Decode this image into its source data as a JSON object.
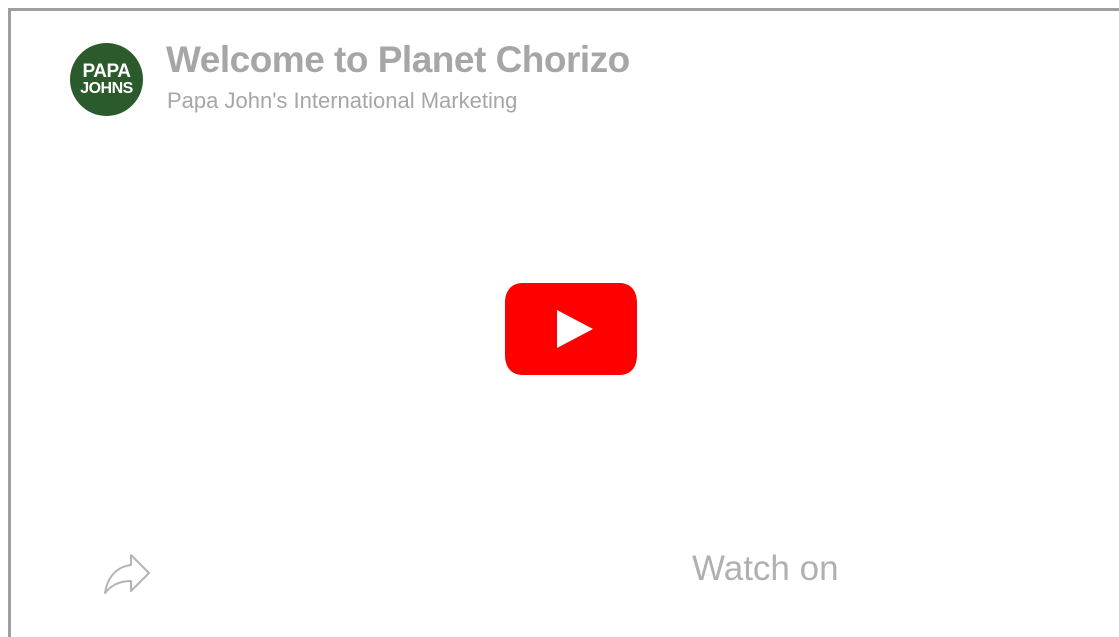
{
  "video": {
    "title": "Welcome to Planet Chorizo",
    "channel": "Papa John's International Marketing"
  },
  "channel_logo": {
    "line1": "PAPA",
    "line2": "JOHNS",
    "color": "#2b5a2d"
  },
  "controls": {
    "play_icon": "youtube-play-icon",
    "share_icon": "share-arrow-icon",
    "watch_on_label": "Watch on"
  },
  "colors": {
    "play_red": "#ff0000",
    "muted_text": "#a6a6a6",
    "border": "#9e9e9e"
  }
}
